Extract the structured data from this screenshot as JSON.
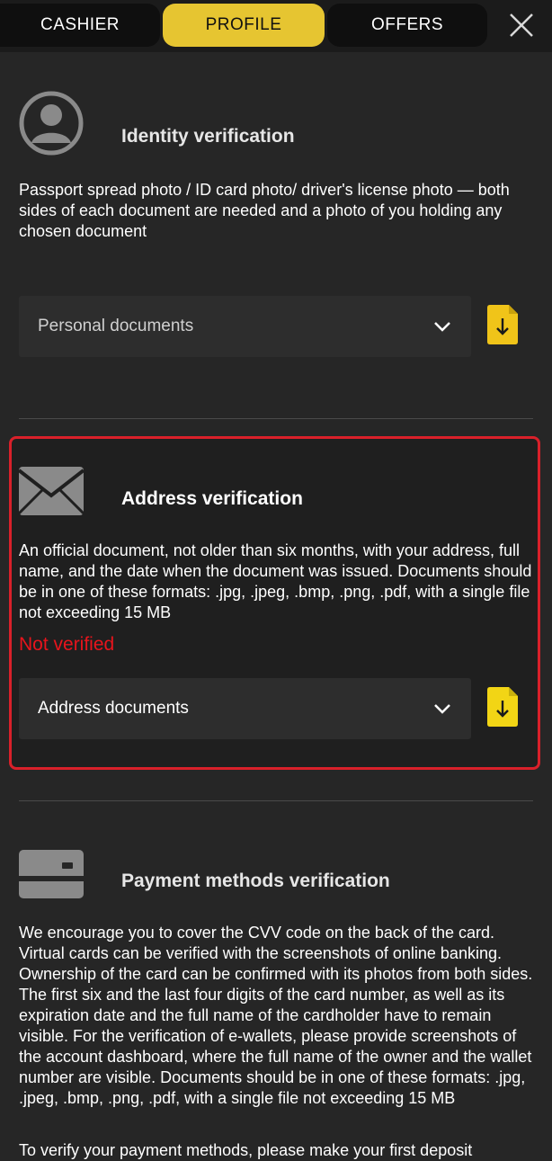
{
  "tabs": [
    {
      "label": "CASHIER",
      "active": false
    },
    {
      "label": "PROFILE",
      "active": true
    },
    {
      "label": "OFFERS",
      "active": false
    }
  ],
  "colors": {
    "accent": "#e6c531",
    "background": "#262626",
    "error": "#e8141c",
    "highlight_border": "#d9202a"
  },
  "sections": {
    "identity": {
      "icon": "user-avatar-icon",
      "title": "Identity verification",
      "description": "Passport spread photo / ID card photo/ driver's license photo — both sides of each document are needed and a photo of you holding any chosen document",
      "dropdown_label": "Personal documents"
    },
    "address": {
      "icon": "envelope-icon",
      "title": "Address verification",
      "description": "An official document, not older than six months, with your address, full name, and the date when the document was issued. Documents should be in one of these formats: .jpg, .jpeg, .bmp, .png, .pdf, with a single file not exceeding 15 MB",
      "status": "Not verified",
      "dropdown_label": "Address documents"
    },
    "payment": {
      "icon": "credit-card-icon",
      "title": "Payment methods verification",
      "description": "We encourage you to cover the CVV code on the back of the card. Virtual cards can be verified with the screenshots of online banking. Ownership of the card can be confirmed with its photos from both sides. The first six and the last four digits of the card number, as well as its expiration date and the full name of the cardholder have to remain visible. For the verification of e-wallets, please provide screenshots of the account dashboard, where the full name of the owner and the wallet number are visible. Documents should be in one of these formats: .jpg, .jpeg, .bmp, .png, .pdf, with a single file not exceeding 15 MB",
      "footer_text": "To verify your payment methods, please make your first deposit"
    }
  }
}
